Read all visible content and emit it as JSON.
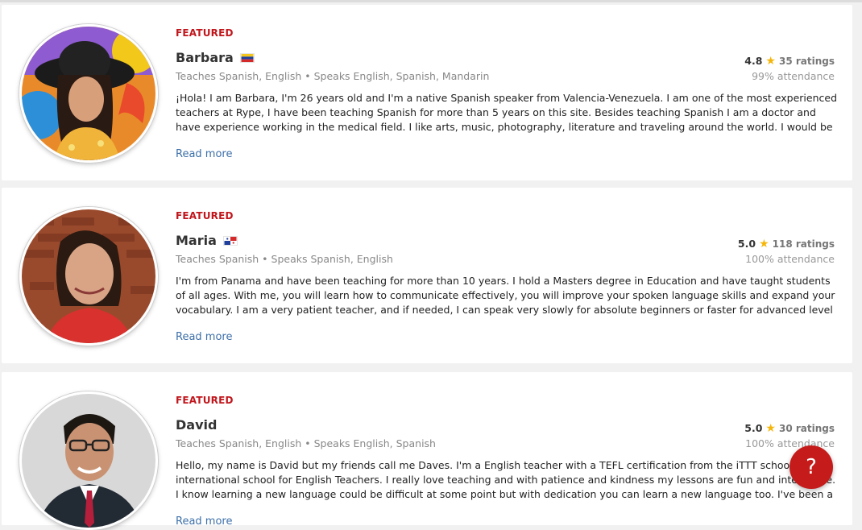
{
  "tutors": [
    {
      "featured_label": "FEATURED",
      "name": "Barbara",
      "flag": "venezuela-flag",
      "teaches": "Teaches Spanish, English • Speaks English, Spanish, Mandarin",
      "rating": "4.8",
      "ratings_count": "35 ratings",
      "attendance": "99% attendance",
      "bio": "¡Hola! I am Barbara, I'm 26 years old and I'm a native Spanish speaker from Valencia-Venezuela. I am one of the most experienced teachers at Rype, I have been teaching Spanish for more than 5 years on this site. Besides teaching Spanish I am a doctor and have experience working in the medical field. I like arts, music, photography, literature and traveling around the world. I would be ...",
      "read_more": "Read more"
    },
    {
      "featured_label": "FEATURED",
      "name": "Maria",
      "flag": "panama-flag",
      "teaches": "Teaches Spanish • Speaks Spanish, English",
      "rating": "5.0",
      "ratings_count": "118 ratings",
      "attendance": "100% attendance",
      "bio": "I'm from Panama and have been teaching for more than 10 years. I hold a Masters degree in Education and have taught students of all ages. With me, you will learn how to communicate effectively, you will improve your spoken language skills and expand your vocabulary. I am a very patient teacher, and if needed, I can speak very slowly for absolute beginners or faster for advanced level stude...",
      "read_more": "Read more"
    },
    {
      "featured_label": "FEATURED",
      "name": "David",
      "flag": "",
      "teaches": "Teaches Spanish, English • Speaks English, Spanish",
      "rating": "5.0",
      "ratings_count": "30 ratings",
      "attendance": "100% attendance",
      "bio": "Hello, my name is David but my friends call me Daves. I'm a English teacher with a TEFL certification from the iTTT school an international school for English Teachers. I really love teaching and with patience and kindness my lessons are fun and interactive. I know learning a new language could be difficult at some point but with dedication you can learn a new language too. I've been a tutor for ov...",
      "read_more": "Read more"
    }
  ],
  "help_button": {
    "label": "?",
    "icon": "question-icon"
  },
  "colors": {
    "featured": "#c0161c",
    "link": "#3d6fa8",
    "star": "#f5b60a",
    "help": "#c51b1b"
  }
}
